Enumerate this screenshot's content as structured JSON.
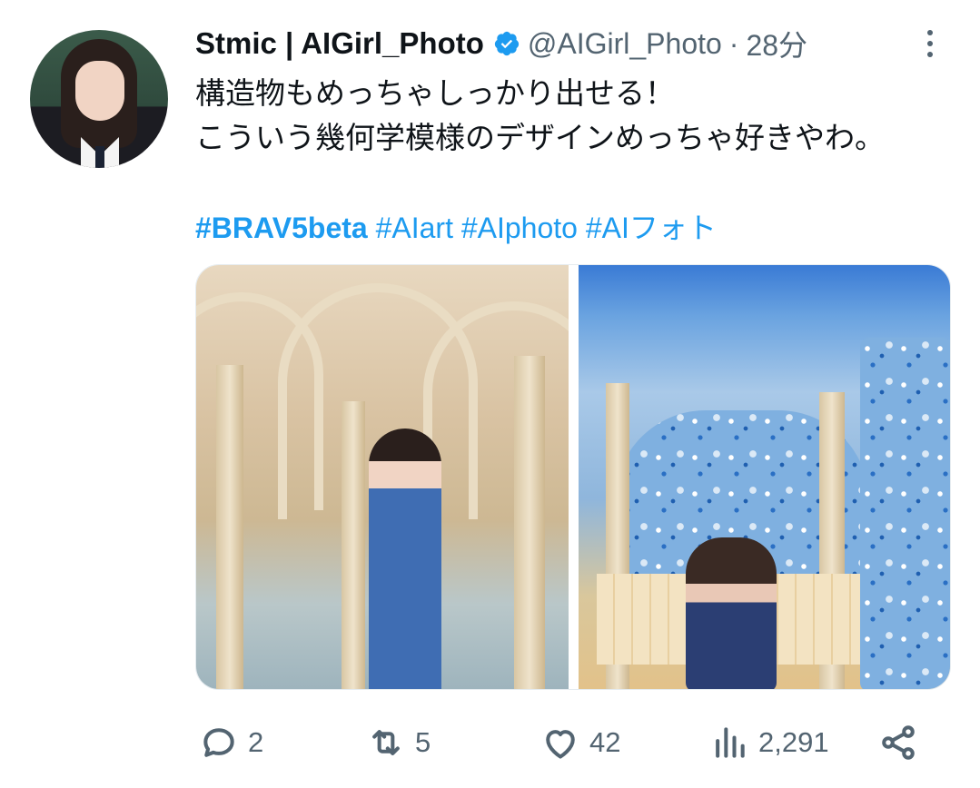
{
  "author": {
    "name": "Stmic | AIGirl_Photo",
    "handle": "@AIGirl_Photo",
    "separator": "·",
    "time": "28分",
    "verified_color": "#1d9bf0"
  },
  "tweet": {
    "lines": [
      "構造物もめっちゃしっかり出せる！",
      "こういう幾何学模様のデザインめっちゃ好きやわ。"
    ],
    "hashtags": [
      "#BRAV5beta",
      "#AIart",
      "#AIphoto",
      "#AIフォト"
    ]
  },
  "media": {
    "count": 2,
    "icons": [
      "photo-arcade-icon",
      "photo-mosaic-icon"
    ]
  },
  "actions": {
    "reply_count": "2",
    "retweet_count": "5",
    "like_count": "42",
    "views_count": "2,291"
  },
  "colors": {
    "text": "#0f1419",
    "secondary": "#536471",
    "link": "#1d9bf0"
  }
}
